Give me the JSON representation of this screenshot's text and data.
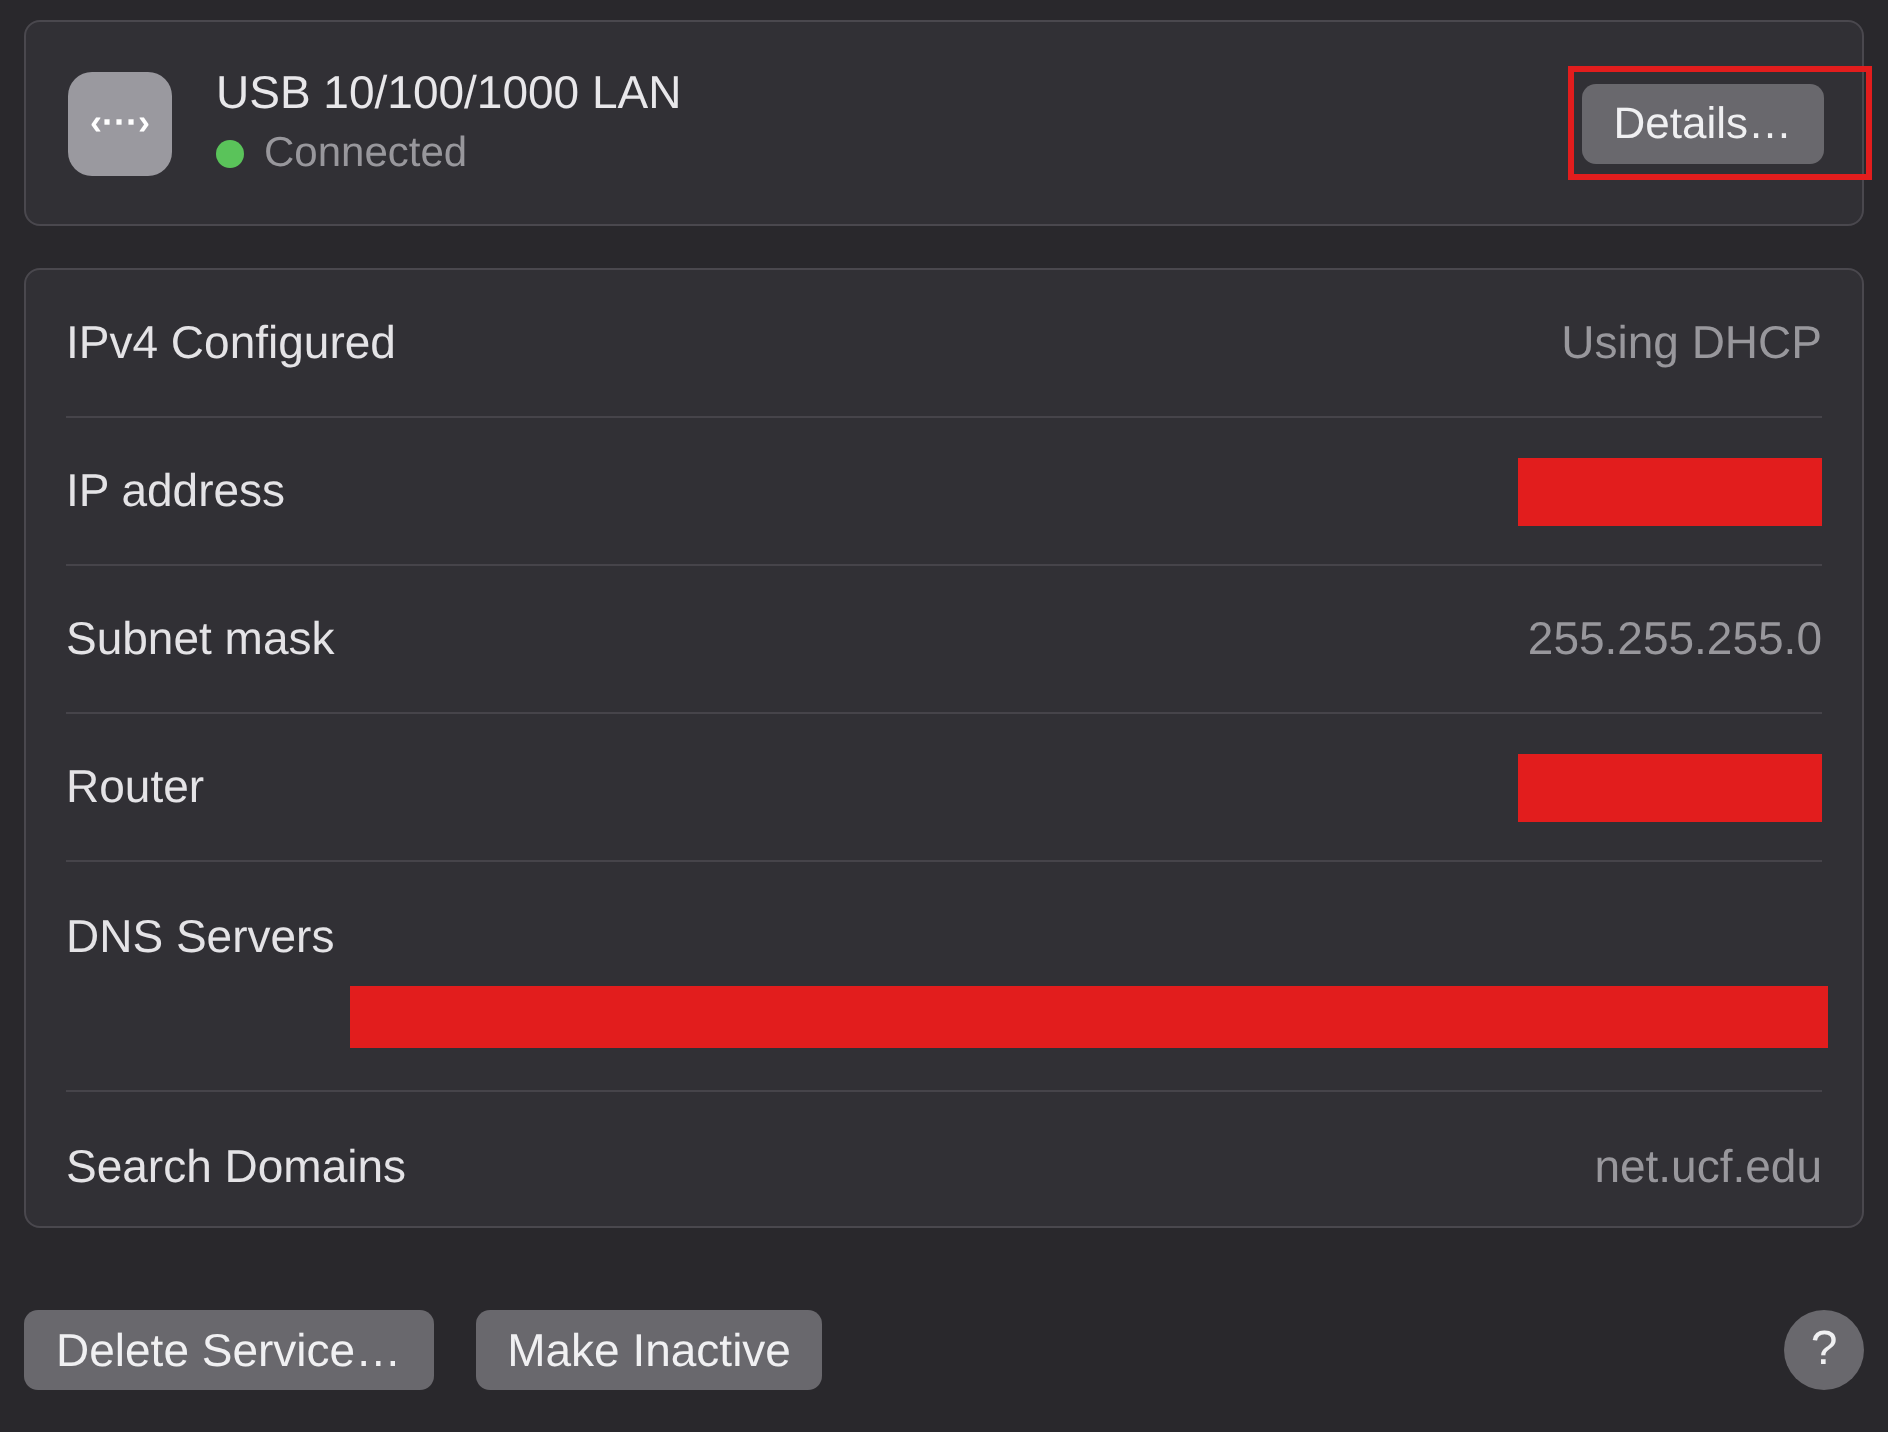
{
  "service": {
    "name": "USB 10/100/1000 LAN",
    "status": "Connected",
    "connected": true,
    "icon": "‹···›"
  },
  "details_button": {
    "label": "Details…",
    "highlighted": true
  },
  "rows": [
    {
      "kind": "value",
      "label": "IPv4 Configured",
      "value": "Using DHCP"
    },
    {
      "kind": "redacted",
      "label": "IP address"
    },
    {
      "kind": "value",
      "label": "Subnet mask",
      "value": "255.255.255.0"
    },
    {
      "kind": "redacted",
      "label": "Router"
    },
    {
      "kind": "redacted_below",
      "label": "DNS Servers"
    },
    {
      "kind": "value",
      "label": "Search Domains",
      "value": "net.ucf.edu"
    }
  ],
  "buttons": [
    "Delete Service…",
    "Make Inactive"
  ],
  "help": "?"
}
